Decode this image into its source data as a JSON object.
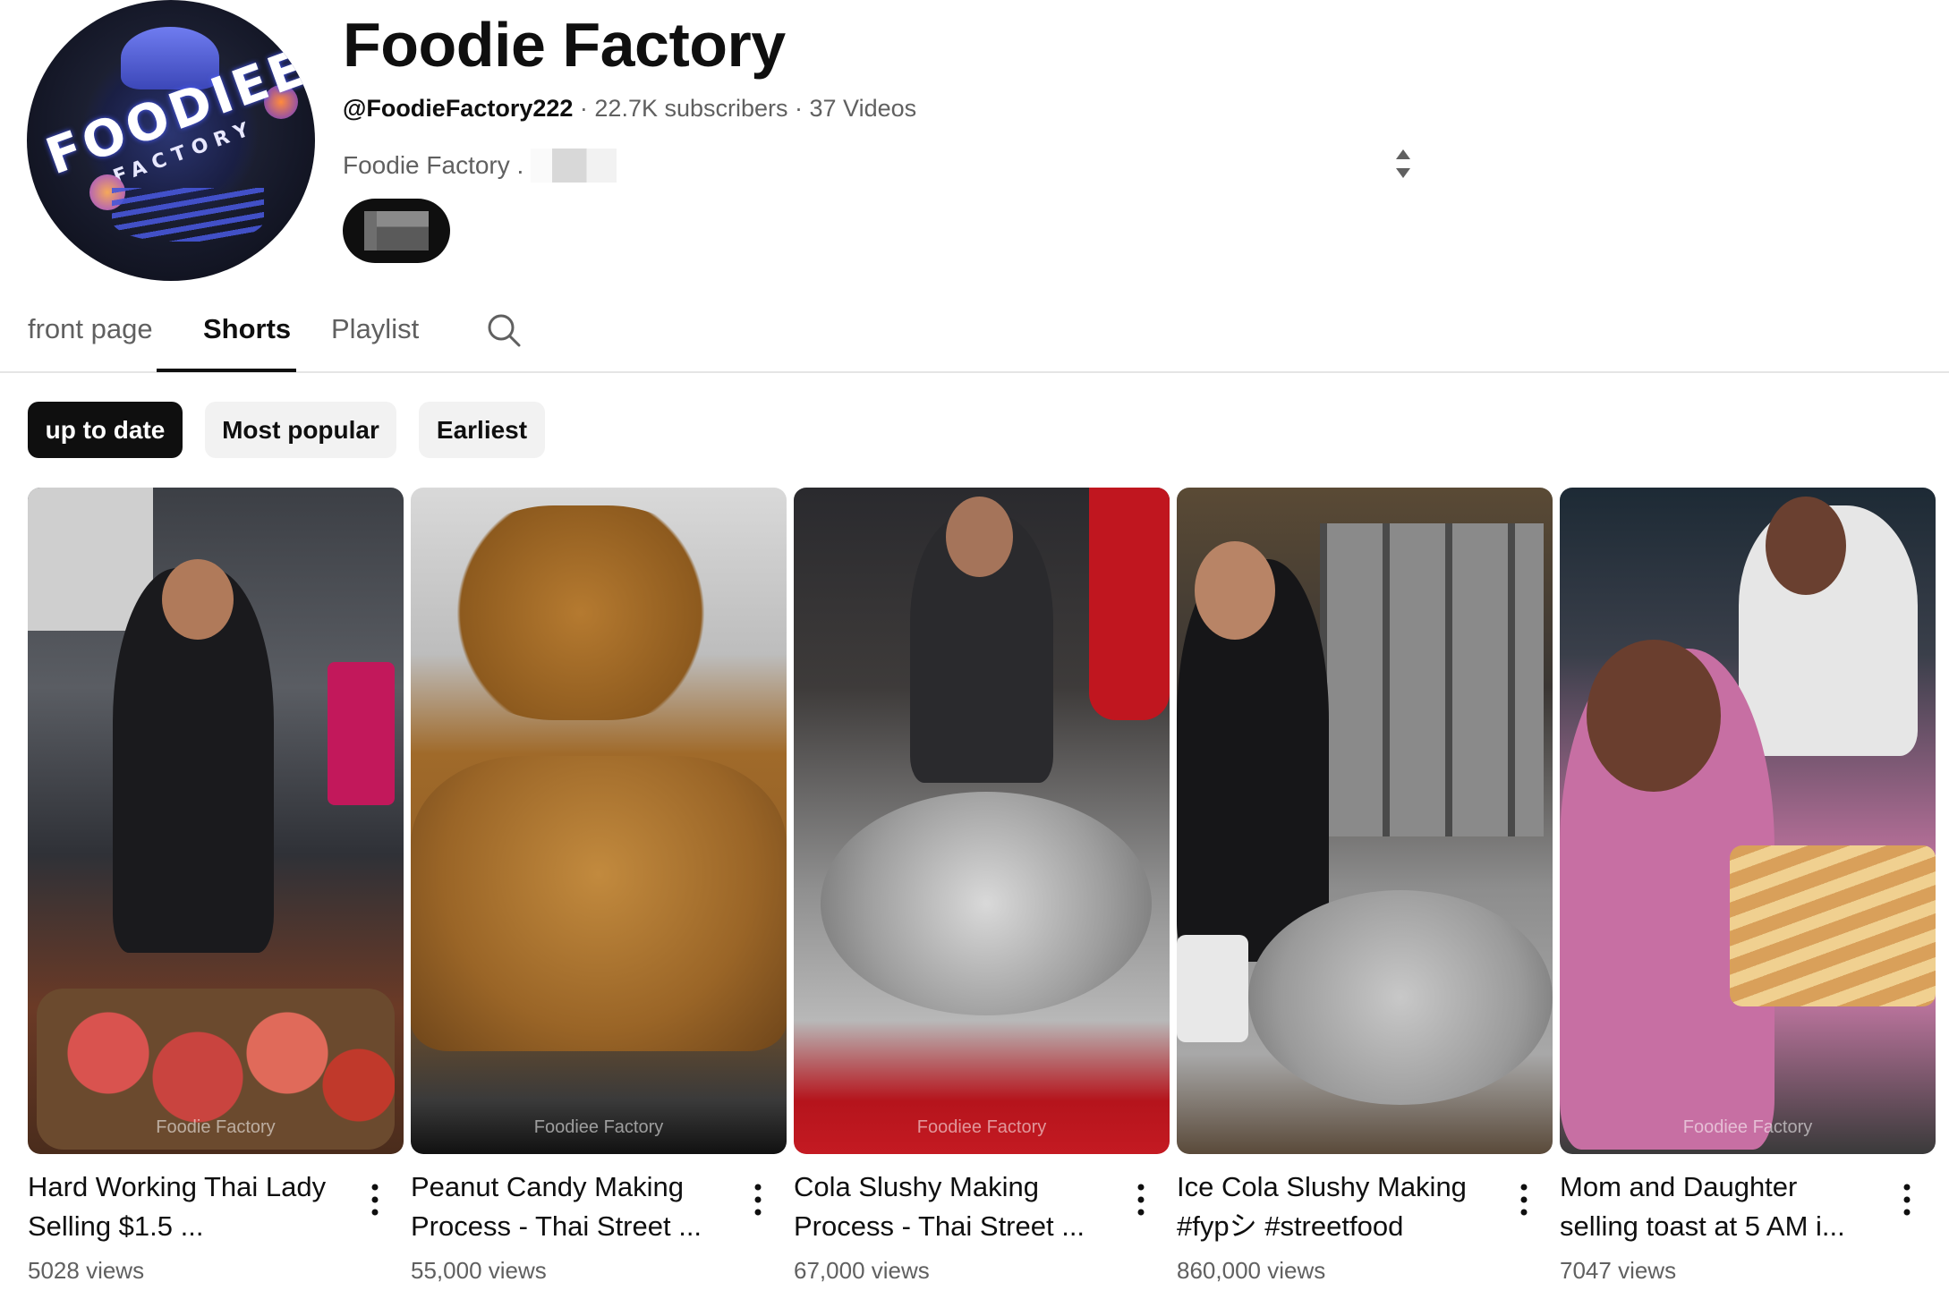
{
  "channel": {
    "name": "Foodie Factory",
    "handle": "@FoodieFactory222",
    "subscribers": "22.7K subscribers",
    "videos": "37 Videos",
    "separator": " · ",
    "description": "Foodie Factory .",
    "avatar_text_main": "FOODIEE",
    "avatar_text_sub": "FACTORY"
  },
  "tabs": [
    {
      "label": "front page",
      "active": false
    },
    {
      "label": "Shorts",
      "active": true
    },
    {
      "label": "Playlist",
      "active": false
    }
  ],
  "chips": [
    {
      "label": "up to date",
      "selected": true
    },
    {
      "label": "Most popular",
      "selected": false
    },
    {
      "label": "Earliest",
      "selected": false
    }
  ],
  "shorts": [
    {
      "title_line1": "Hard Working Thai Lady",
      "title_line2": "Selling $1.5 ...",
      "views": "5028 views",
      "watermark": "Foodie Factory"
    },
    {
      "title_line1": "Peanut Candy Making",
      "title_line2": "Process - Thai Street ...",
      "views": "55,000 views",
      "watermark": "Foodiee Factory"
    },
    {
      "title_line1": "Cola Slushy Making",
      "title_line2": "Process - Thai Street ...",
      "views": "67,000 views",
      "watermark": "Foodiee Factory"
    },
    {
      "title_line1": "Ice Cola Slushy Making",
      "title_line2": "#fypシ #streetfood",
      "views": "860,000 views",
      "watermark": ""
    },
    {
      "title_line1": "Mom and Daughter",
      "title_line2": "selling toast at 5 AM i...",
      "views": "7047 views",
      "watermark": "Foodiee Factory"
    }
  ],
  "icons": {
    "search": "search-icon",
    "expand": "expand-icon",
    "more": "more-vertical-icon"
  },
  "colors": {
    "text_primary": "#0f0f0f",
    "text_secondary": "#606060",
    "chip_bg": "#f2f2f2",
    "chip_selected_bg": "#0f0f0f",
    "divider": "#e5e5e5"
  }
}
